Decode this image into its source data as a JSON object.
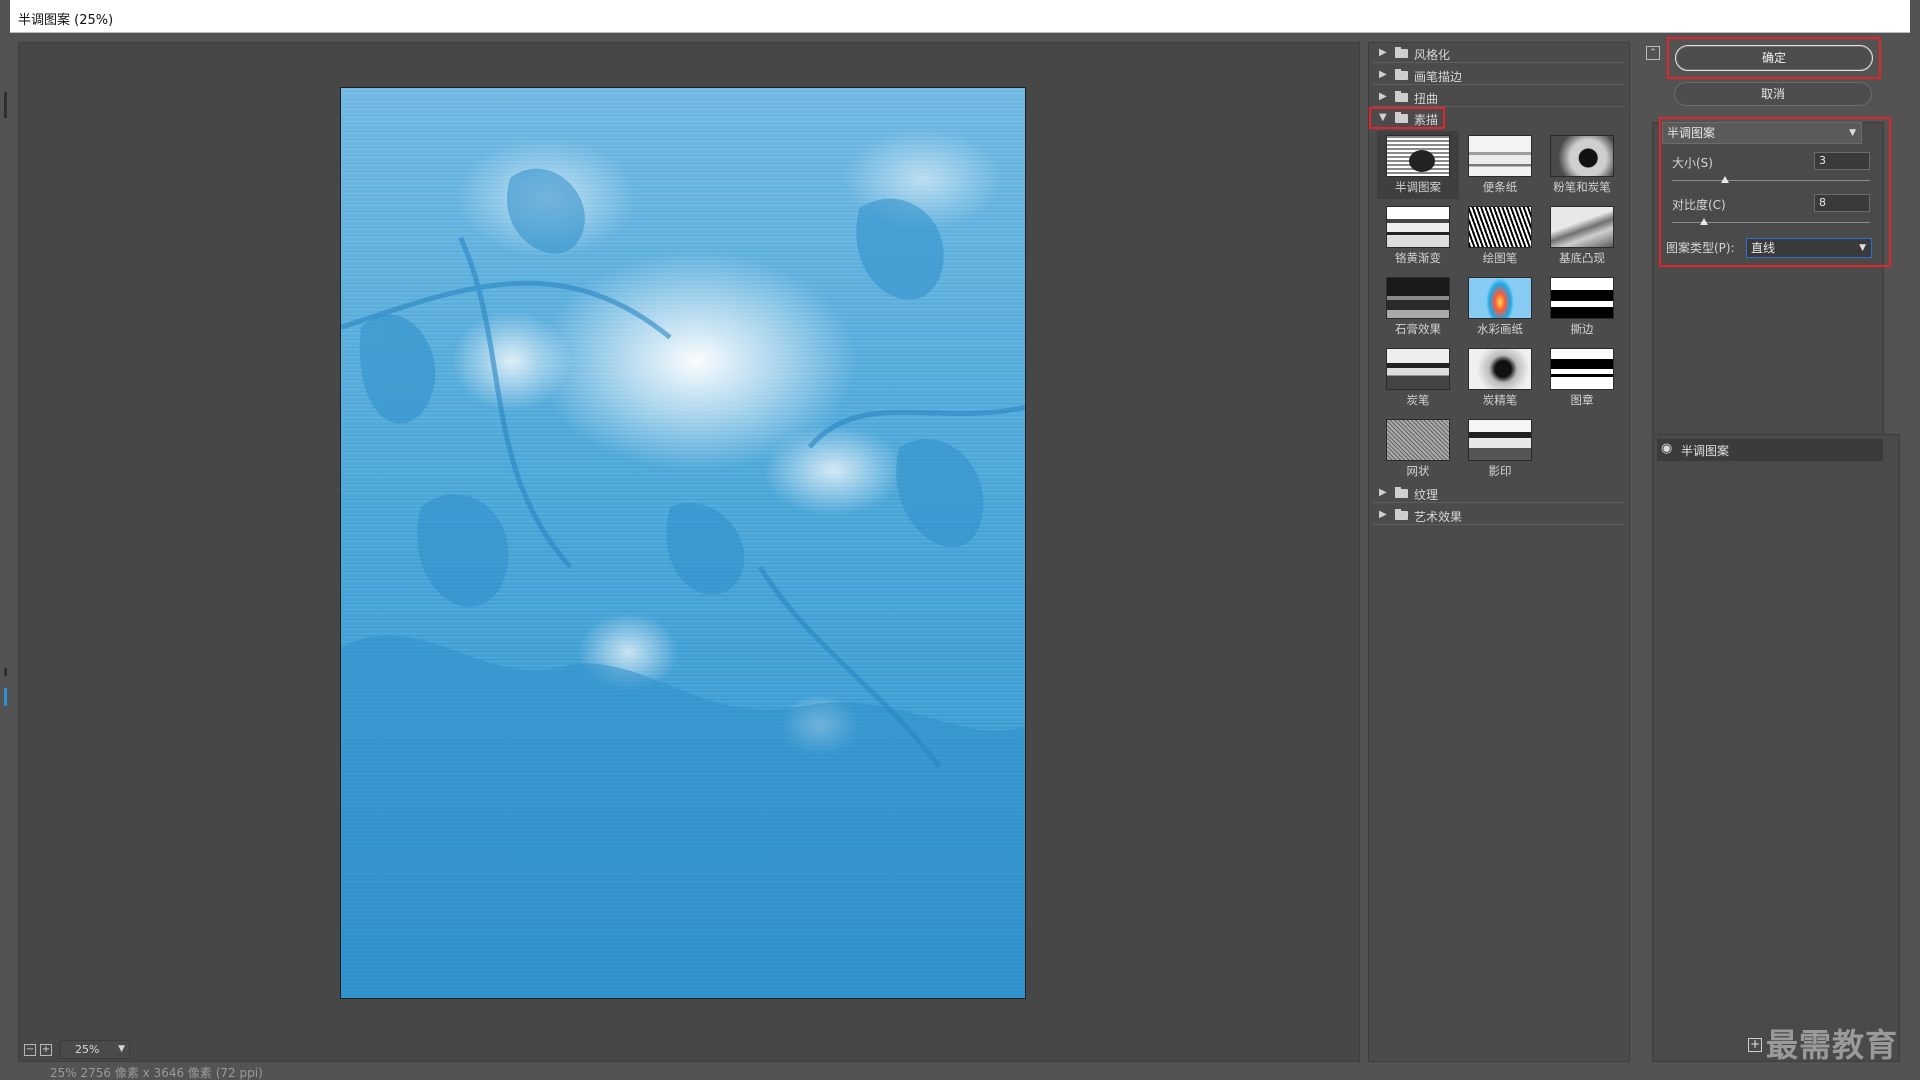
{
  "window": {
    "title": "半调图案 (25%)"
  },
  "preview": {
    "zoom": "25%",
    "status": "25% 2756 像素 x 3646 像素 (72 ppi)"
  },
  "gallery": {
    "categories_top": [
      {
        "label": "风格化"
      },
      {
        "label": "画笔描边"
      },
      {
        "label": "扭曲"
      }
    ],
    "open_category": {
      "label": "素描"
    },
    "filters": [
      {
        "label": "半调图案",
        "texture": "t-halftone",
        "selected": true
      },
      {
        "label": "便条纸",
        "texture": "t-note"
      },
      {
        "label": "粉笔和炭笔",
        "texture": "t-chalk"
      },
      {
        "label": "铬黄渐变",
        "texture": "t-chrome"
      },
      {
        "label": "绘图笔",
        "texture": "t-pen"
      },
      {
        "label": "基底凸现",
        "texture": "t-bas"
      },
      {
        "label": "石膏效果",
        "texture": "t-plaster"
      },
      {
        "label": "水彩画纸",
        "texture": "t-water"
      },
      {
        "label": "撕边",
        "texture": "t-torn"
      },
      {
        "label": "炭笔",
        "texture": "t-charcoal"
      },
      {
        "label": "炭精笔",
        "texture": "t-conte"
      },
      {
        "label": "图章",
        "texture": "t-stamp"
      },
      {
        "label": "网状",
        "texture": "t-reticul"
      },
      {
        "label": "影印",
        "texture": "t-photocopy"
      }
    ],
    "categories_bottom": [
      {
        "label": "纹理"
      },
      {
        "label": "艺术效果"
      }
    ]
  },
  "actions": {
    "ok_label": "确定",
    "cancel_label": "取消"
  },
  "settings": {
    "filter_name": "半调图案",
    "size": {
      "label": "大小(S)",
      "value": "3",
      "fraction": 0.27
    },
    "contrast": {
      "label": "对比度(C)",
      "value": "8",
      "fraction": 0.16
    },
    "pattern_type": {
      "label": "图案类型(P):",
      "value": "直线"
    }
  },
  "layers": [
    {
      "label": "半调图案",
      "visible": true
    }
  ],
  "watermark": "最需教育",
  "colors": {
    "accent_red": "#e0262b",
    "canvas_blue": "#3a9bd4"
  }
}
